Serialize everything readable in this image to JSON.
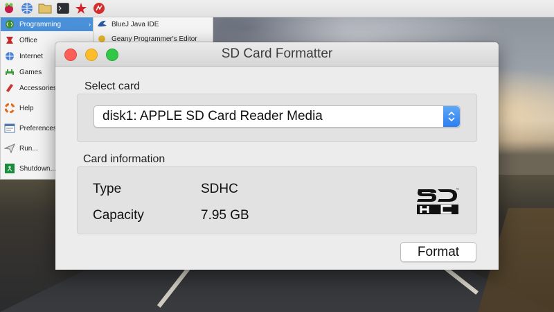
{
  "menu": {
    "items": [
      {
        "label": "Programming",
        "icon": "programming-icon"
      },
      {
        "label": "Office",
        "icon": "office-icon"
      },
      {
        "label": "Internet",
        "icon": "internet-icon"
      },
      {
        "label": "Games",
        "icon": "games-icon"
      },
      {
        "label": "Accessories",
        "icon": "accessories-icon"
      },
      {
        "label": "Help",
        "icon": "help-icon"
      },
      {
        "label": "Preferences",
        "icon": "preferences-icon"
      },
      {
        "label": "Run...",
        "icon": "run-icon"
      },
      {
        "label": "Shutdown...",
        "icon": "shutdown-icon"
      }
    ],
    "submenu": [
      {
        "label": "BlueJ Java IDE",
        "icon": "bluej-icon"
      },
      {
        "label": "Geany Programmer's Editor",
        "icon": "geany-icon"
      }
    ],
    "selected_color": "#4a90d9"
  },
  "window": {
    "title": "SD Card Formatter",
    "select_card_label": "Select card",
    "selected_card": "disk1: APPLE SD Card Reader Media",
    "card_info_label": "Card information",
    "type_label": "Type",
    "type_value": "SDHC",
    "capacity_label": "Capacity",
    "capacity_value": "7.95 GB",
    "format_button": "Format",
    "logo_text": "SD HC"
  }
}
